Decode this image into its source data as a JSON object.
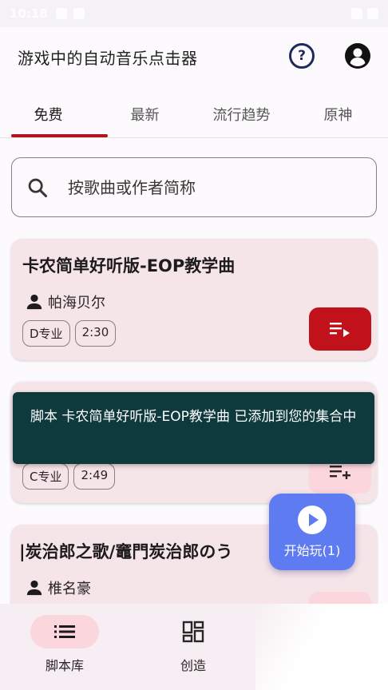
{
  "status_bar": {
    "time": "10:18"
  },
  "app_bar": {
    "title": "游戏中的自动音乐点击器",
    "help_label": "?"
  },
  "tabs": [
    {
      "label": "免费"
    },
    {
      "label": "最新"
    },
    {
      "label": "流行趋势"
    },
    {
      "label": "原神"
    }
  ],
  "search": {
    "placeholder": "按歌曲或作者简称",
    "value": ""
  },
  "cards": [
    {
      "title": "卡农简单好听版-EOP教学曲",
      "author": "帕海贝尔",
      "level": "D专业",
      "duration": "2:30",
      "action_icon": "playlist-play-icon"
    },
    {
      "title": "",
      "author": "",
      "level": "C专业",
      "duration": "2:49",
      "action_icon": "playlist-add-icon"
    },
    {
      "title": "|炭治郎之歌/竈門炭治郎のう",
      "author": "椎名豪"
    }
  ],
  "snackbar": {
    "message": "脚本 卡农简单好听版-EOP教学曲 已添加到您的集合中"
  },
  "fab": {
    "label": "开始玩(1)"
  },
  "bottom_nav": [
    {
      "label": "脚本库",
      "icon": "list-icon"
    },
    {
      "label": "创造",
      "icon": "dashboard-icon"
    }
  ],
  "colors": {
    "accent_red": "#c1111a",
    "tab_indicator": "#b3131c",
    "card_bg": "#f5e4e8",
    "snackbar_bg": "#0e3a3e",
    "fab_bg": "#5f7bf2"
  }
}
